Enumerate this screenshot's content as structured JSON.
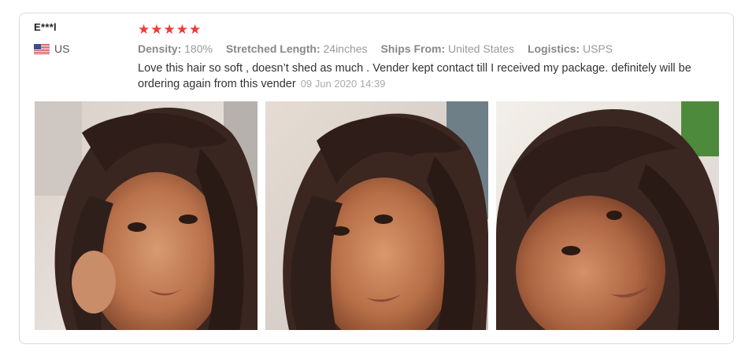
{
  "review": {
    "user_name": "E***l",
    "country": "US",
    "rating": 5,
    "stars": [
      "★",
      "★",
      "★",
      "★",
      "★"
    ],
    "specs": [
      {
        "key": "Density:",
        "value": "180%"
      },
      {
        "key": "Stretched Length:",
        "value": "24inches"
      },
      {
        "key": "Ships From:",
        "value": "United States"
      },
      {
        "key": "Logistics:",
        "value": "USPS"
      }
    ],
    "comment": "Love this hair so soft , doesn’t shed as much . Vender kept contact till I received my package. definitely will be ordering again from this vender",
    "date": "09 Jun 2020 14:39",
    "photos": [
      {
        "icon": "review-photo-selfie-1"
      },
      {
        "icon": "review-photo-selfie-2"
      },
      {
        "icon": "review-photo-selfie-3"
      }
    ]
  },
  "colors": {
    "star": "#f23a3a",
    "border": "#d9d9d9",
    "text": "#333333",
    "muted": "#999999"
  }
}
